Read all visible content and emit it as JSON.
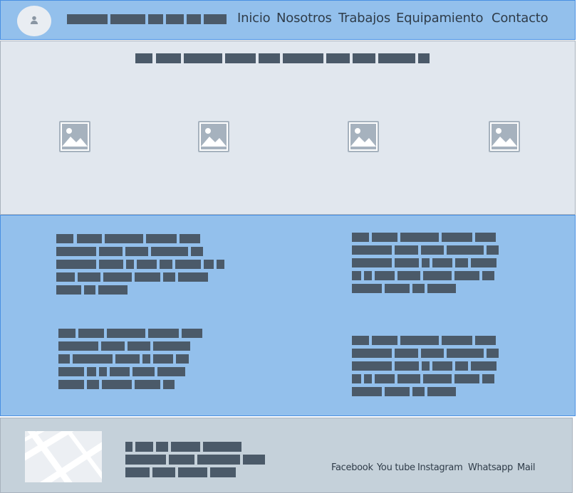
{
  "nav": {
    "links": [
      {
        "label": "Inicio"
      },
      {
        "label": "Nosotros"
      },
      {
        "label": "Trabajos"
      },
      {
        "label": "Equipamiento"
      },
      {
        "label": "Contacto"
      }
    ]
  },
  "footer": {
    "social_links": [
      {
        "label": "Facebook"
      },
      {
        "label": "You tube"
      },
      {
        "label": "Instagram"
      },
      {
        "label": "Whatsapp"
      },
      {
        "label": "Mail"
      }
    ]
  },
  "icons": {
    "avatar": "user-icon",
    "gallery_images": "image-icon",
    "map": "map-placeholder"
  },
  "colors": {
    "header_bg": "#93c0ec",
    "header_border": "#4a90e2",
    "gallery_bg": "#e1e7ee",
    "info_bg": "#93c0ec",
    "footer_bg": "#c5d1da",
    "placeholder_text": "#4b5a69",
    "image_placeholder": "#a6b2be"
  }
}
